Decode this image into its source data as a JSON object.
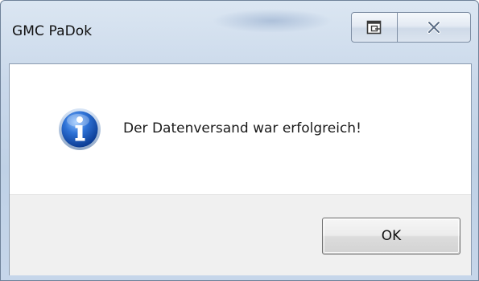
{
  "window": {
    "title": "GMC PaDok"
  },
  "titlebar": {
    "restore_icon": "restore-icon",
    "close_icon": "close-icon"
  },
  "dialog": {
    "icon": "info-icon",
    "message": "Der Datenversand war erfolgreich!",
    "ok_label": "OK"
  }
}
